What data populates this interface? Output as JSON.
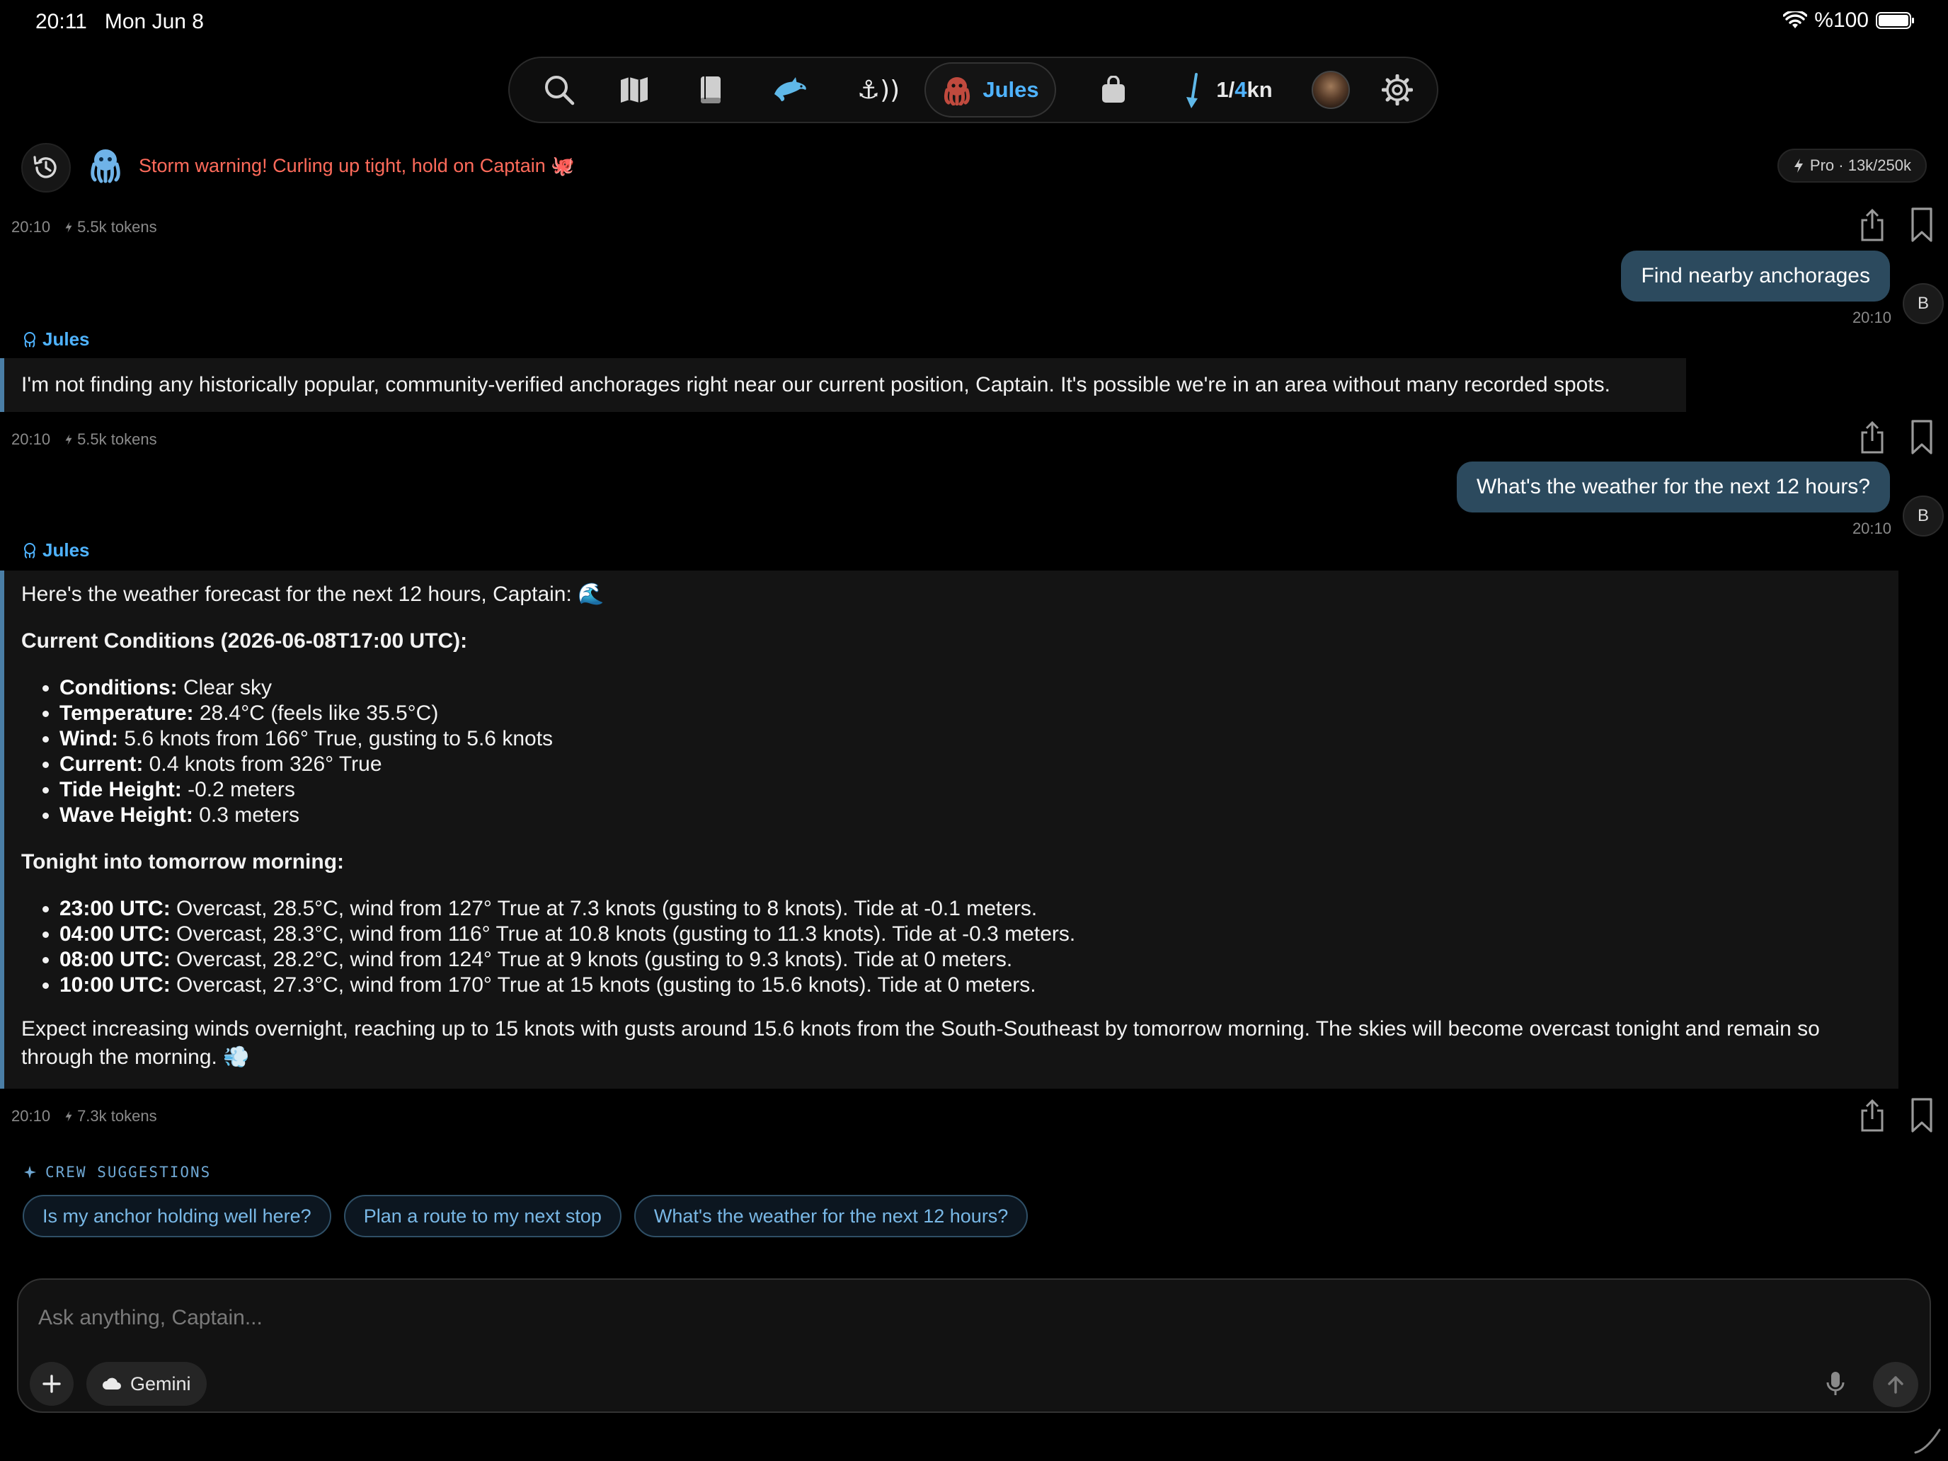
{
  "status_bar": {
    "time": "20:11",
    "date": "Mon Jun 8",
    "battery": "%100"
  },
  "toolbar": {
    "icons": [
      "search-icon",
      "map-icon",
      "book-icon",
      "dolphin-icon",
      "anchor-alarm-icon",
      "crew-member-icon",
      "bag-icon",
      "wind-arrow-icon",
      "avatar",
      "gear-icon"
    ],
    "anchor_label": "⚓︎))",
    "active_crew": "Jules",
    "wind_current": "1",
    "wind_sep": "/",
    "wind_max": "4",
    "wind_unit": "kn"
  },
  "banner": {
    "storm_text": "Storm warning! Curling up tight, hold on Captain 🐙",
    "plan": "Pro · 13k/250k"
  },
  "messages": [
    {
      "time": "20:10",
      "tokens": "5.5k tokens"
    },
    {
      "text": "Find nearby anchorages",
      "time": "20:10",
      "avatar": "B"
    },
    {
      "sender": "Jules",
      "text": "I'm not finding any historically popular, community-verified anchorages right near our current position, Captain. It's possible we're in an area without many recorded spots."
    },
    {
      "time": "20:10",
      "tokens": "5.5k tokens"
    },
    {
      "text": "What's the weather for the next 12 hours?",
      "time": "20:10",
      "avatar": "B"
    },
    {
      "sender": "Jules",
      "intro": "Here's the weather forecast for the next 12 hours, Captain: 🌊",
      "current_heading": "Current Conditions (2026-06-08T17:00 UTC):",
      "current_items": [
        {
          "label": "Conditions:",
          "value": " Clear sky"
        },
        {
          "label": "Temperature:",
          "value": " 28.4°C (feels like 35.5°C)"
        },
        {
          "label": "Wind:",
          "value": " 5.6 knots from 166° True, gusting to 5.6 knots"
        },
        {
          "label": "Current:",
          "value": " 0.4 knots from 326° True"
        },
        {
          "label": "Tide Height:",
          "value": " -0.2 meters"
        },
        {
          "label": "Wave Height:",
          "value": " 0.3 meters"
        }
      ],
      "tonight_heading": "Tonight into tomorrow morning:",
      "tonight_items": [
        {
          "label": "23:00 UTC:",
          "value": " Overcast, 28.5°C, wind from 127° True at 7.3 knots (gusting to 8 knots). Tide at -0.1 meters."
        },
        {
          "label": "04:00 UTC:",
          "value": " Overcast, 28.3°C, wind from 116° True at 10.8 knots (gusting to 11.3 knots). Tide at -0.3 meters."
        },
        {
          "label": "08:00 UTC:",
          "value": " Overcast, 28.2°C, wind from 124° True at 9 knots (gusting to 9.3 knots). Tide at 0 meters."
        },
        {
          "label": "10:00 UTC:",
          "value": " Overcast, 27.3°C, wind from 170° True at 15 knots (gusting to 15.6 knots). Tide at 0 meters."
        }
      ],
      "outro": "Expect increasing winds overnight, reaching up to 15 knots with gusts around 15.6 knots from the South-Southeast by tomorrow morning. The skies will become overcast tonight and remain so through the morning. 💨"
    },
    {
      "time": "20:10",
      "tokens": "7.3k tokens"
    }
  ],
  "suggestions": {
    "label": "CREW SUGGESTIONS",
    "chips": [
      "Is my anchor holding well here?",
      "Plan a route to my next stop",
      "What's the weather for the next 12 hours?"
    ]
  },
  "composer": {
    "placeholder": "Ask anything, Captain...",
    "model": "Gemini"
  },
  "colors": {
    "accent": "#4fb3ff",
    "user_bubble": "#2c4a5e",
    "storm": "#ff6b5b",
    "assistant_border": "#4a7ea6"
  }
}
